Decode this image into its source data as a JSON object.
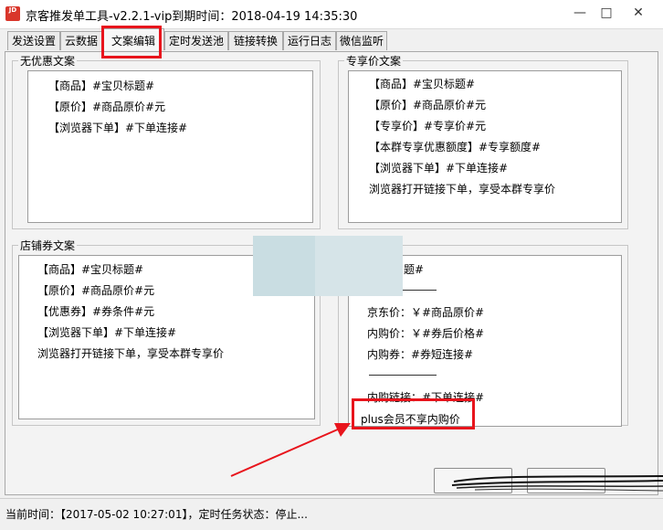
{
  "window": {
    "icon_label": "JD",
    "title": "京客推发单工具-v2.2.1-vip到期时间：2018-04-19 14:35:30",
    "minimize_icon": "minimize-icon",
    "maximize_icon": "maximize-icon",
    "close_icon": "close-icon"
  },
  "tabs": [
    {
      "label": "发送设置"
    },
    {
      "label": "云数据"
    },
    {
      "label": "文案编辑",
      "active": true
    },
    {
      "label": "定时发送池"
    },
    {
      "label": "链接转换"
    },
    {
      "label": "运行日志"
    },
    {
      "label": "微信监听"
    }
  ],
  "groups": {
    "no_coupon": {
      "label": "无优惠文案",
      "lines": [
        "【商品】#宝贝标题#",
        "【原价】#商品原价#元",
        "【浏览器下单】#下单连接#"
      ]
    },
    "exclusive": {
      "label": "专享价文案",
      "lines": [
        "【商品】#宝贝标题#",
        "【原价】#商品原价#元",
        "【专享价】#专享价#元",
        "【本群专享优惠额度】#专享额度#",
        "【浏览器下单】#下单连接#",
        "浏览器打开链接下单，享受本群专享价"
      ]
    },
    "shop_coupon": {
      "label": "店铺券文案",
      "lines": [
        "【商品】#宝贝标题#",
        "【原价】#商品原价#元",
        "【优惠券】#券条件#元",
        "【浏览器下单】#下单连接#",
        "浏览器打开链接下单，享受本群专享价"
      ]
    },
    "fourth": {
      "lines": [
        "题#",
        "京东价：￥#商品原价#",
        "内购价：￥#券后价格#",
        "内购券：#券短连接#",
        "内购链接：#下单连接#",
        "plus会员不享内购价"
      ]
    }
  },
  "status": {
    "text": "当前时间：【2017-05-02 10:27:01】，定时任务状态：停止..."
  },
  "colors": {
    "highlight": "#e8141c"
  }
}
